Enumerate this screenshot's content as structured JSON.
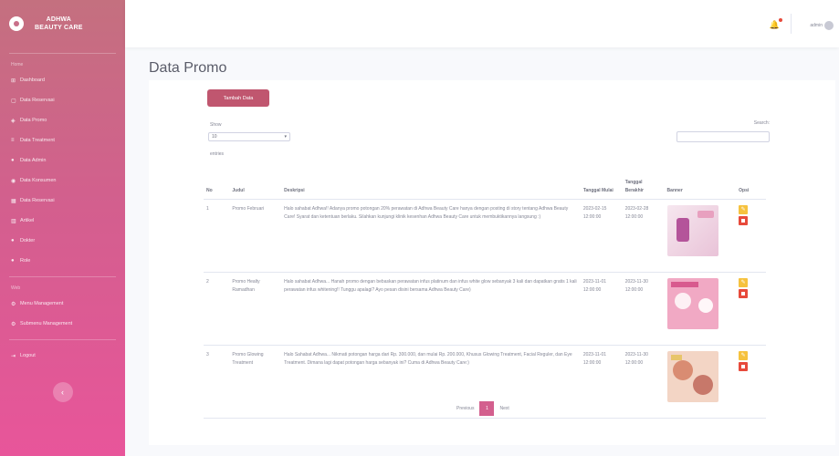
{
  "brand": {
    "line1": "ADHWA",
    "line2": "BEAUTY CARE"
  },
  "sidebar": {
    "heading1": "Home",
    "items": [
      {
        "icon": "dashboard-icon",
        "glyph": "⊞",
        "label": "Dashboard"
      },
      {
        "icon": "folder-icon",
        "glyph": "▢",
        "label": "Data Reservasi"
      },
      {
        "icon": "tag-icon",
        "glyph": "◈",
        "label": "Data Promo"
      },
      {
        "icon": "list-icon",
        "glyph": "≡",
        "label": "Data Treatment"
      },
      {
        "icon": "user-icon",
        "glyph": "●",
        "label": "Data Admin"
      },
      {
        "icon": "users-icon",
        "glyph": "◉",
        "label": "Data Konsumen"
      },
      {
        "icon": "calendar-icon",
        "glyph": "▦",
        "label": "Data Reservasi"
      },
      {
        "icon": "chart-icon",
        "glyph": "▥",
        "label": "Artikel"
      },
      {
        "icon": "user-icon",
        "glyph": "●",
        "label": "Dokter"
      },
      {
        "icon": "user-icon",
        "glyph": "●",
        "label": "Role"
      }
    ],
    "heading2": "Web",
    "items2": [
      {
        "icon": "settings-icon",
        "glyph": "⚙",
        "label": "Menu Management"
      },
      {
        "icon": "settings-icon",
        "glyph": "⚙",
        "label": "Submenu Management"
      }
    ],
    "logout": {
      "icon": "logout-icon",
      "glyph": "⇥",
      "label": "Logout"
    },
    "toggle_glyph": "‹"
  },
  "topbar": {
    "user": "admin"
  },
  "page": {
    "title": "Data Promo"
  },
  "actions": {
    "add_label": "Tambah Data"
  },
  "datatable": {
    "show_label": "Show",
    "length_value": "10",
    "entries_label": "entries",
    "search_label": "Search:",
    "columns": [
      "No",
      "Judul",
      "Deskripsi",
      "Tanggal Mulai",
      "Tanggal Berakhir",
      "Banner",
      "Opsi"
    ],
    "rows": [
      {
        "no": "1",
        "judul": "Promo Februari",
        "deskripsi": "Halo sahabat Adhwa!! Adanya promo potongan 20% perawatan di Adhwa Beauty Care hanya dengan posting di story tentang Adhwa Beauty Care! Syarat dan ketentuan berlaku. Silahkan kunjungi klinik kesenhan Adhwa Beauty Care untuk membuktikannya langsung :)",
        "mulai": "2023-02-15 12:00:00",
        "berakhir": "2023-02-28 12:00:00"
      },
      {
        "no": "2",
        "judul": "Promo Healty Ramadhan",
        "deskripsi": "Halo sahabat Adhwa... Hanah promo dengan bebaskan perawatan infus platinum dan infus white glow sebanyak 3 kali dan dapatkan gratis 1 kali perawatan infus whitening!! Tunggu apalagi? Ayo pesan disini bersama Adhwa Beauty Care)",
        "mulai": "2023-11-01 12:00:00",
        "berakhir": "2023-11-30 12:00:00"
      },
      {
        "no": "3",
        "judul": "Promo Glowing Treatment",
        "deskripsi": "Halo Sahabat Adhwa... Nikmati potongan harga dari Rp. 300.000, dan mulai Rp. 200.000, Khusus Glowing Treatment, Facial Reguler, dan Eye Treatment. Dimana lagi dapat potongan harga sebanyak ini? Cuma di Adhwa Beauty Care:)",
        "mulai": "2023-11-01 12:00:00",
        "berakhir": "2023-11-30 12:00:00"
      }
    ],
    "pagination": {
      "prev": "Previous",
      "current": "1",
      "next": "Next"
    }
  }
}
